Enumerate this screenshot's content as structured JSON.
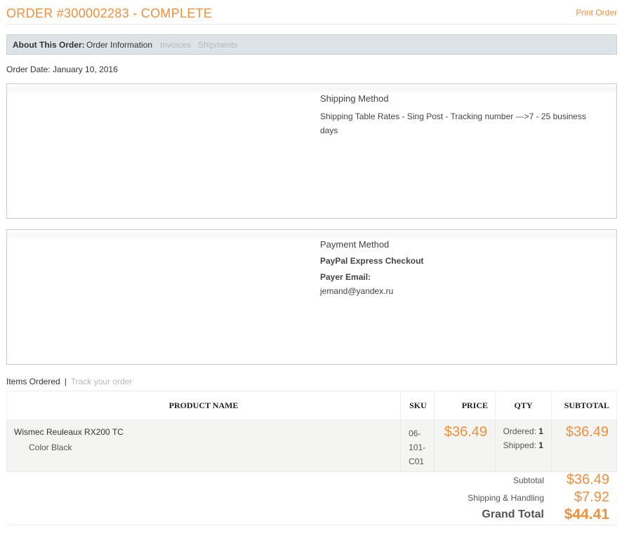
{
  "header": {
    "title": "ORDER #300002283 - COMPLETE",
    "print_link": "Print Order"
  },
  "about_bar": {
    "label": "About This Order:",
    "current_tab": "Order Information",
    "tabs": [
      "Invoices",
      "Shipments"
    ]
  },
  "order_date": "Order Date: January 10, 2016",
  "shipping": {
    "heading": "Shipping Method",
    "text": "Shipping Table Rates - Sing Post - Tracking number --->7 - 25 business days"
  },
  "payment": {
    "heading": "Payment Method",
    "method": "PayPal Express Checkout",
    "payer_email_label": "Payer Email:",
    "payer_email": "jemand@yandex.ru"
  },
  "items_tabs": {
    "current": "Items Ordered",
    "separator": "|",
    "link": "Track your order"
  },
  "table": {
    "headers": {
      "name": "PRODUCT NAME",
      "sku": "SKU",
      "price": "PRICE",
      "qty": "QTY",
      "subtotal": "SUBTOTAL"
    },
    "rows": [
      {
        "name": "Wismec Reuleaux RX200 TC",
        "option": "Color Black",
        "sku_lines": [
          "06-",
          "101-",
          "C01"
        ],
        "price": "$36.49",
        "ordered_label": "Ordered:",
        "ordered_qty": "1",
        "shipped_label": "Shipped:",
        "shipped_qty": "1",
        "subtotal": "$36.49"
      }
    ]
  },
  "totals": {
    "subtotal_label": "Subtotal",
    "subtotal": "$36.49",
    "shipping_label": "Shipping & Handling",
    "shipping": "$7.92",
    "grand_label": "Grand Total",
    "grand": "$44.41"
  },
  "colors": {
    "accent": "#f18f3c",
    "bar_bg": "#dde3e6",
    "muted_link": "#b4b9bc"
  }
}
